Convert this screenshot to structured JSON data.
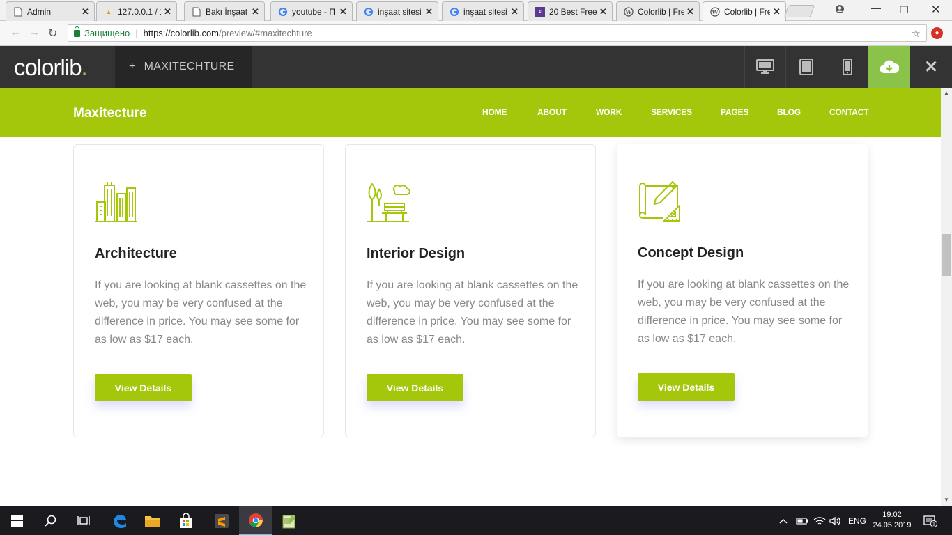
{
  "browser": {
    "tabs": [
      {
        "title": "Admin",
        "favicon": "doc",
        "active": false
      },
      {
        "title": "127.0.0.1 / 1",
        "favicon": "pma",
        "active": false
      },
      {
        "title": "Bakı İnşaat S",
        "favicon": "doc",
        "active": false
      },
      {
        "title": "youtube - П",
        "favicon": "google",
        "active": false
      },
      {
        "title": "inşaat sitesi",
        "favicon": "google",
        "active": false
      },
      {
        "title": "inşaat sitesi",
        "favicon": "google",
        "active": false
      },
      {
        "title": "20 Best Free",
        "favicon": "colorlib",
        "active": false
      },
      {
        "title": "Colorlib | Fre",
        "favicon": "wordpress",
        "active": false
      },
      {
        "title": "Colorlib | Fre",
        "favicon": "wordpress",
        "active": true
      }
    ],
    "secure_label": "Защищено",
    "url_host": "https://colorlib.com",
    "url_path": "/preview/#maxitechture"
  },
  "preview_bar": {
    "logo": "colorlib",
    "logo_dot": ".",
    "theme_plus": "+",
    "theme_name": "MAXITECHTURE",
    "accent_color": "#8bc34a"
  },
  "site": {
    "brand": "Maxitecture",
    "accent_color": "#a4c60b",
    "menu": [
      "HOME",
      "ABOUT",
      "WORK",
      "SERVICES",
      "PAGES",
      "BLOG",
      "CONTACT"
    ],
    "cards": [
      {
        "icon": "buildings-icon",
        "title": "Architecture",
        "text": "If you are looking at blank cassettes on the web, you may be very confused at the difference in price. You may see some for as low as $17 each.",
        "button": "View Details"
      },
      {
        "icon": "park-bench-icon",
        "title": "Interior Design",
        "text": "If you are looking at blank cassettes on the web, you may be very confused at the difference in price. You may see some for as low as $17 each.",
        "button": "View Details"
      },
      {
        "icon": "blueprint-pencil-icon",
        "title": "Concept Design",
        "text": "If you are looking at blank cassettes on the web, you may be very confused at the difference in price. You may see some for as low as $17 each.",
        "button": "View Details"
      }
    ]
  },
  "taskbar": {
    "language": "ENG",
    "time": "19:02",
    "date": "24.05.2019",
    "notification_count": "1"
  }
}
